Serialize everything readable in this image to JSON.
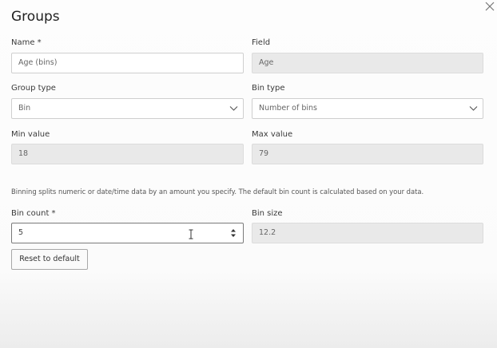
{
  "dialog": {
    "title": "Groups"
  },
  "fields": {
    "name": {
      "label": "Name *",
      "value": "Age (bins)"
    },
    "field": {
      "label": "Field",
      "value": "Age"
    },
    "group_type": {
      "label": "Group type",
      "value": "Bin"
    },
    "bin_type": {
      "label": "Bin type",
      "value": "Number of bins"
    },
    "min_value": {
      "label": "Min value",
      "value": "18"
    },
    "max_value": {
      "label": "Max value",
      "value": "79"
    },
    "bin_count": {
      "label": "Bin count *",
      "value": "5"
    },
    "bin_size": {
      "label": "Bin size",
      "value": "12.2"
    }
  },
  "help_text": "Binning splits numeric or date/time data by an amount you specify. The default bin count is calculated based on your data.",
  "buttons": {
    "reset_label": "Reset to default"
  },
  "icons": {
    "close": "close-icon",
    "dropdown": "chevron-down-icon",
    "spinner": "spinner-arrows-icon",
    "text_cursor": "text-cursor-icon"
  },
  "colors": {
    "readonly_bg": "#e9e9e9",
    "border": "#cfcfcf",
    "active_border": "#7a7a7a"
  }
}
